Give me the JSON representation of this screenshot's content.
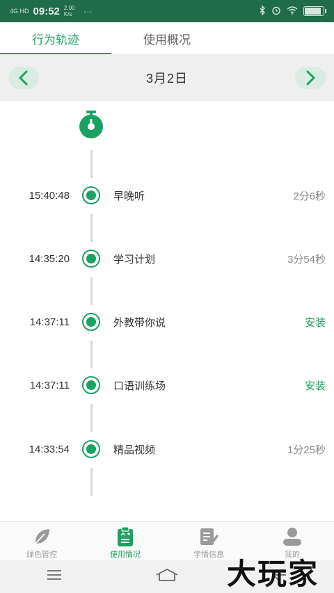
{
  "status_bar": {
    "carrier": "4G HD",
    "time": "09:52",
    "speed": "2.00 K/s",
    "dots": "···",
    "battery": "90"
  },
  "tabs": [
    {
      "label": "行为轨迹",
      "active": true
    },
    {
      "label": "使用概况",
      "active": false
    }
  ],
  "date_bar": {
    "date": "3月2日",
    "prev_icon": "chevron-left-icon",
    "next_icon": "chevron-right-icon"
  },
  "timeline": {
    "start_icon": "stopwatch-icon",
    "entries": [
      {
        "time": "15:40:48",
        "label": "早晚听",
        "value": "2分6秒",
        "action": false
      },
      {
        "time": "14:35:20",
        "label": "学习计划",
        "value": "3分54秒",
        "action": false
      },
      {
        "time": "14:37:11",
        "label": "外教带你说",
        "value": "安装",
        "action": true
      },
      {
        "time": "14:37:11",
        "label": "口语训练场",
        "value": "安装",
        "action": true
      },
      {
        "time": "14:33:54",
        "label": "精品视频",
        "value": "1分25秒",
        "action": false
      }
    ]
  },
  "bottom_nav": [
    {
      "label": "绿色管控",
      "icon": "leaf-icon",
      "active": false
    },
    {
      "label": "使用情况",
      "icon": "clipboard-icon",
      "active": true
    },
    {
      "label": "学情信息",
      "icon": "document-edit-icon",
      "active": false
    },
    {
      "label": "我的",
      "icon": "user-icon",
      "active": false
    }
  ],
  "system_nav": {
    "menu_icon": "menu-icon",
    "home_icon": "home-icon",
    "back_icon": "back-icon"
  },
  "watermark": "大玩家",
  "colors": {
    "accent": "#1aa260",
    "status_bar": "#1f6b4a",
    "date_bar_bg": "#efefef"
  }
}
